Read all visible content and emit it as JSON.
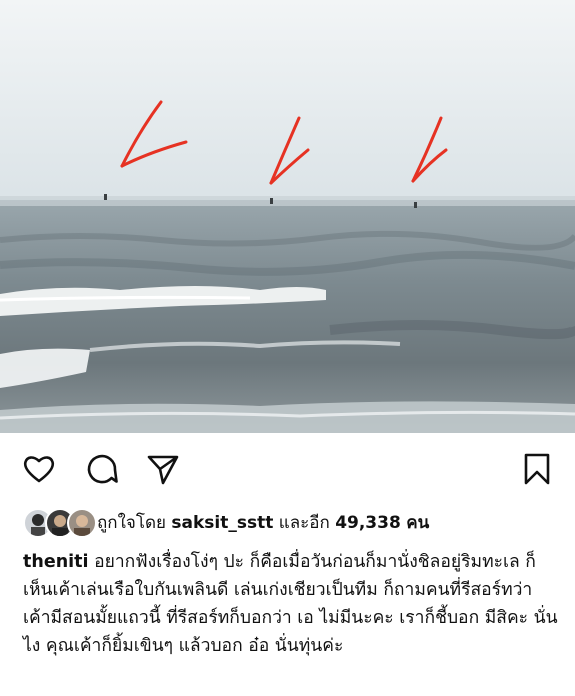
{
  "post": {
    "image_alt": "Sea with three distant sailboats marked by red arrows",
    "liked_by_prefix": "ถูกใจโดย",
    "liked_by_user": "saksit_sstt",
    "liked_by_middle": "และอีก",
    "liked_by_count": "49,338",
    "liked_by_suffix": "คน",
    "caption_user": "theniti",
    "caption_text": " อยากฟังเรื่องโง่ๆ ปะ ก็คือเมื่อวันก่อนก็มานั่งชิลอยู่ริมทะเล ก็เห็นเค้าเล่นเรือใบกันเพลินดี เล่นเก่งเชียวเป็นทีม ก็ถามคนที่รีสอร์ทว่าเค้ามีสอนมั้ยแถวนี้ ที่รีสอร์ทก็บอกว่า เอ ไม่มีนะคะ เราก็ชี้บอก มีสิคะ นั่นไง คุณเค้าก็ยิ้มเขินๆ แล้วบอก อ๋อ นั่นทุ่นค่ะ"
  },
  "icons": {
    "like": "heart-icon",
    "comment": "comment-bubble-icon",
    "share": "paper-plane-icon",
    "save": "bookmark-icon"
  },
  "colors": {
    "arrow": "#e63223",
    "sky": "#e9eef1",
    "sea": "#6f7c82",
    "text": "#111111"
  }
}
